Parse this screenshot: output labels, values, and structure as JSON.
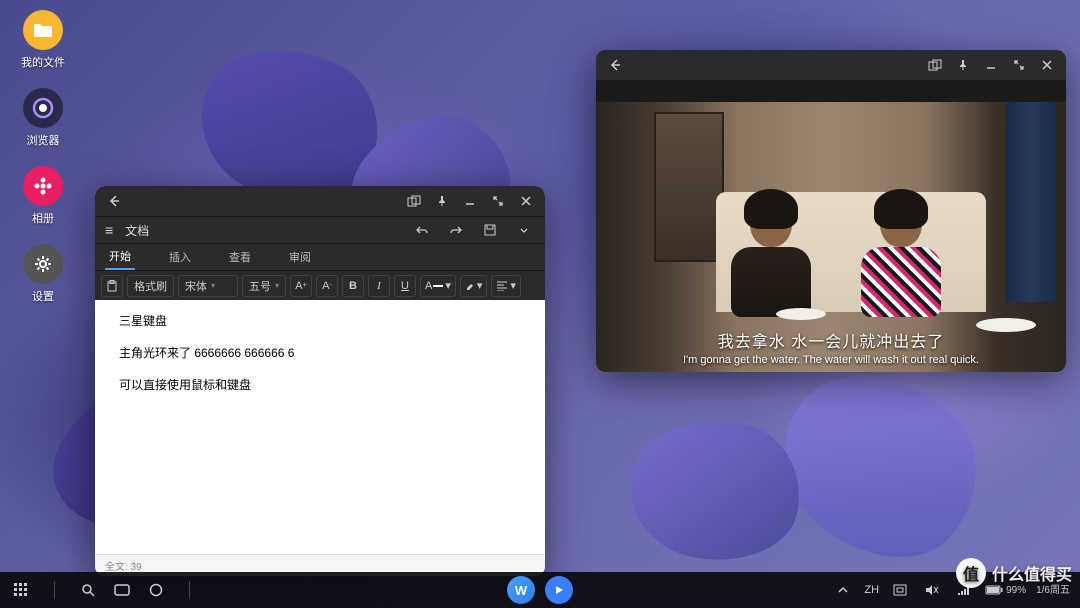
{
  "desktop": {
    "icons": [
      {
        "name": "files",
        "label": "我的文件"
      },
      {
        "name": "browser",
        "label": "浏览器"
      },
      {
        "name": "gallery",
        "label": "相册"
      },
      {
        "name": "settings",
        "label": "设置"
      }
    ]
  },
  "editor": {
    "title": "文档",
    "tabs": {
      "start": "开始",
      "insert": "插入",
      "view": "查看",
      "review": "审阅"
    },
    "format": {
      "brush": "格式刷",
      "font": "宋体",
      "size": "五号"
    },
    "content": {
      "line1": "三星键盘",
      "line2": "主角光环来了  6666666   666666  6",
      "line3": "可以直接使用鼠标和键盘"
    },
    "status": "全文: 39"
  },
  "video": {
    "subtitle_cn": "我去拿水  水一会儿就冲出去了",
    "subtitle_en": "I'm gonna get the water. The water will wash it out real quick."
  },
  "taskbar": {
    "ime": "ZH",
    "battery": "99%",
    "time": "",
    "date": "1/6周五"
  },
  "watermark": "什么值得买"
}
